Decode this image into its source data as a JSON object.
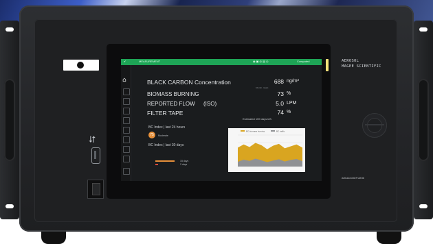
{
  "device": {
    "brand_line1": "AEROSOL",
    "brand_line2": "MAGEE SCIENTIFIC",
    "model": "Aethalometer® AE36"
  },
  "topbar": {
    "status_text": "MEASUREMENT",
    "right_text": "Computed",
    "color": "#1ea456"
  },
  "main": {
    "bc_label": "BLACK CARBON Concentration",
    "bc_value": "688",
    "bc_unit": "ng/m³",
    "bc_subtext": "10-min. mean",
    "biomass_label": "BIOMASS BURNING",
    "biomass_value": "73",
    "biomass_unit": "%",
    "flow_label": "REPORTED FLOW",
    "flow_qualifier": "(ISO)",
    "flow_value": "5.0",
    "flow_unit": "LPM",
    "tape_label": "FILTER TAPE",
    "tape_value": "74",
    "tape_unit": "%",
    "tape_estimate": "Estimated 159 days left."
  },
  "bc_index": {
    "label_24h": "BC Index  |  last 24 hours",
    "value_24h": "75",
    "status_24h": "Moderate",
    "label_30d": "BC Index  |  last 30 days",
    "legend_a": "15 days",
    "legend_b": "2 days",
    "value_a": 15,
    "value_b": 2
  },
  "chart_data": {
    "type": "area",
    "series": [
      {
        "name": "BC biomass burning",
        "color": "#d9a520",
        "values": [
          60,
          70,
          62,
          75,
          68,
          55,
          66,
          72,
          58,
          64,
          70,
          60
        ]
      },
      {
        "name": "BC traffic",
        "color": "#8f9194",
        "values": [
          15,
          22,
          18,
          25,
          20,
          14,
          19,
          23,
          16,
          21,
          24,
          17
        ]
      }
    ]
  },
  "colors": {
    "accent_orange": "#e7903a",
    "legend_red": "#d94b3b",
    "status_yellow": "#f3e27a"
  }
}
